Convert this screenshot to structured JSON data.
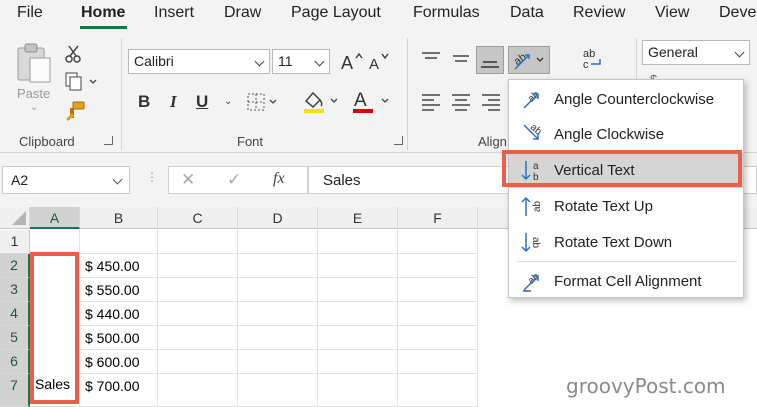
{
  "tabs": [
    "File",
    "Home",
    "Insert",
    "Draw",
    "Page Layout",
    "Formulas",
    "Data",
    "Review",
    "View",
    "Deve"
  ],
  "active_tab": "Home",
  "clipboard": {
    "paste_label": "Paste",
    "group_label": "Clipboard"
  },
  "font": {
    "family": "Calibri",
    "size": "11",
    "bold": "B",
    "italic": "I",
    "underline": "U",
    "font_color_glyph": "A",
    "group_label": "Font",
    "font_color_swatch": "#e00000",
    "fill_color_swatch": "#f2e600"
  },
  "alignment": {
    "group_label": "Align",
    "orientation_glyph": "ab"
  },
  "number": {
    "format": "General"
  },
  "formula_bar": {
    "name_box": "A2",
    "cancel_glyph": "✕",
    "enter_glyph": "✓",
    "fx_glyph": "fx",
    "formula": "Sales"
  },
  "grid": {
    "columns": [
      "A",
      "B",
      "C",
      "D",
      "E",
      "F"
    ],
    "rows": [
      "1",
      "2",
      "3",
      "4",
      "5",
      "6",
      "7"
    ],
    "b_values": [
      "",
      "$ 450.00",
      "$ 550.00",
      "$ 440.00",
      "$ 500.00",
      "$ 600.00",
      "$ 700.00"
    ],
    "a7": "Sales"
  },
  "orientation_menu": {
    "items": [
      {
        "label": "Angle Counterclockwise",
        "icon": "angle-counterclockwise-icon"
      },
      {
        "label": "Angle Clockwise",
        "icon": "angle-clockwise-icon"
      },
      {
        "label": "Vertical Text",
        "icon": "vertical-text-icon",
        "selected": true
      },
      {
        "label": "Rotate Text Up",
        "icon": "rotate-text-up-icon"
      },
      {
        "label": "Rotate Text Down",
        "icon": "rotate-text-down-icon"
      },
      {
        "label": "Format Cell Alignment",
        "icon": "format-cell-alignment-icon"
      }
    ]
  },
  "colors": {
    "accent_green": "#217346",
    "highlight_red": "#e8604a",
    "icon_blue": "#2b73c8"
  },
  "watermark": "groovyPost.com"
}
